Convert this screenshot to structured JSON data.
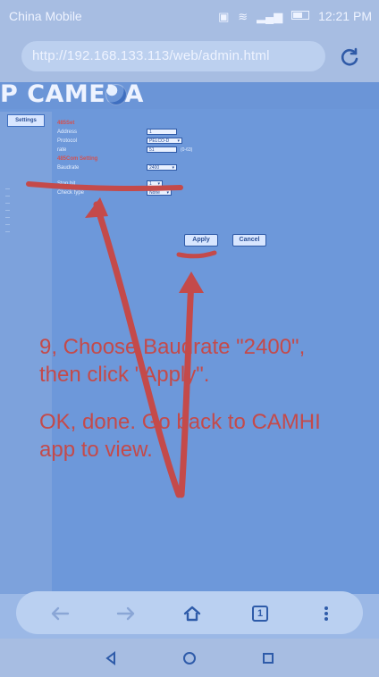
{
  "status_bar": {
    "carrier": "China Mobile",
    "time": "12:21 PM",
    "icons": [
      "hd-icon",
      "wifi-icon",
      "signal-icon",
      "battery-icon"
    ]
  },
  "address_bar": {
    "url": "http://192.168.133.113/web/admin.html",
    "reload_icon": "reload-icon"
  },
  "camera_page": {
    "brand": "P CAMERA",
    "sidebar": {
      "tab": "Settings"
    },
    "form": {
      "section1": "485Set",
      "address_label": "Address",
      "address_value": "1",
      "protocol_label": "Protocol",
      "protocol_value": "PELCO-D",
      "rate_label": "rate",
      "rate_value": "51",
      "rate_unit": "(0-63)",
      "section2": "485Com Setting",
      "baudrate_label": "Baudrate",
      "baudrate_value": "2400",
      "stop_bit_label": "Stop bit",
      "stop_bit_value": "1",
      "check_type_label": "Check type",
      "check_type_value": "None"
    },
    "buttons": {
      "apply": "Apply",
      "cancel": "Cancel"
    }
  },
  "instructions": {
    "line1": "9, Choose Baudrate \"2400\",",
    "line2": "then click \"Apply\".",
    "line3": "OK, done. Go back to CAMHI",
    "line4": "app to view."
  },
  "browser_toolbar": {
    "back_icon": "back-arrow-icon",
    "forward_icon": "forward-arrow-icon",
    "home_icon": "home-icon",
    "tabs_icon": "tabs-icon",
    "tabs_count": "1",
    "menu_icon": "more-vert-icon"
  },
  "system_nav": {
    "back": "nav-back-icon",
    "home": "nav-home-icon",
    "recent": "nav-recent-icon"
  },
  "colors": {
    "annotation_red": "#c44a4a",
    "page_blue": "#6d98da",
    "bar_blue": "#a7bde2"
  }
}
